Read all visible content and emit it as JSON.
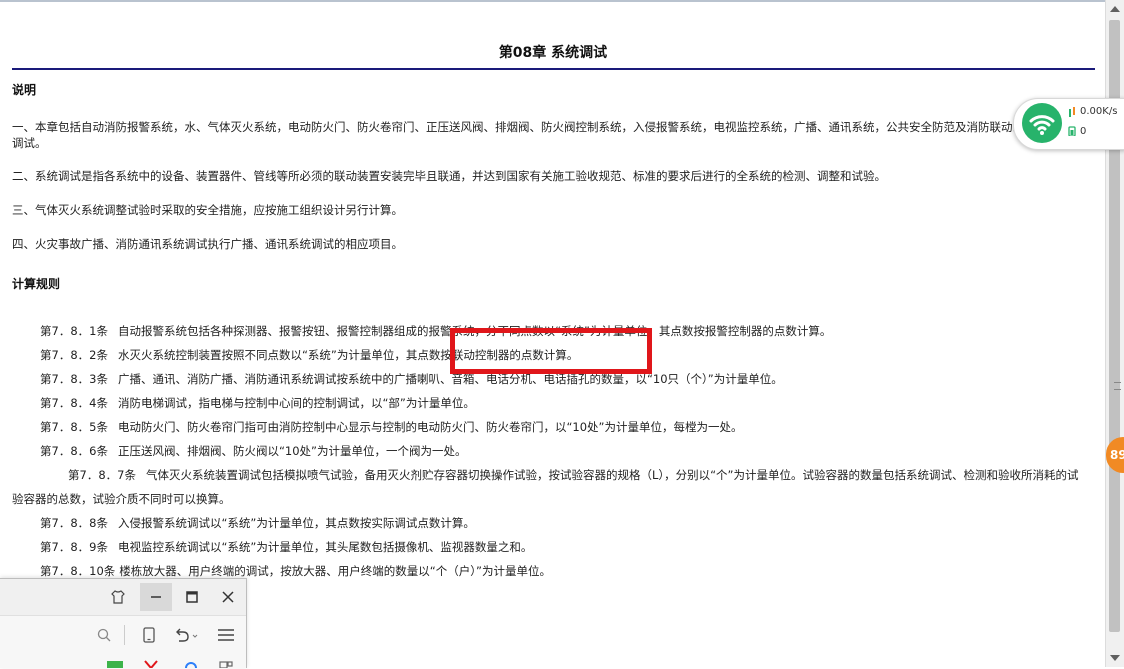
{
  "document": {
    "title": "第08章 系统调试",
    "section_notes_heading": "说明",
    "notes": [
      "一、本章包括自动消防报警系统，水、气体灭火系统，电动防火门、防火卷帘门、正压送风阀、排烟阀、防火阀控制系统，入侵报警系统，电视监控系统，广播、通讯系统，公共安全防范及消防联动系统等的系统调试。",
      "二、系统调试是指各系统中的设备、装置器件、管线等所必须的联动装置安装完毕且联通，并达到国家有关施工验收规范、标准的要求后进行的全系统的检测、调整和试验。",
      "三、气体灭火系统调整试验时采取的安全措施，应按施工组织设计另行计算。",
      "四、火灾事故广播、消防通讯系统调试执行广播、通讯系统调试的相应项目。"
    ],
    "section_rules_heading": "计算规则",
    "rules": [
      {
        "num": "第7．8．1条",
        "text": "自动报警系统包括各种探测器、报警按钮、报警控制器组成的报警系统，分不同点数以“系统”为计量单位，其点数按报警控制器的点数计算。"
      },
      {
        "num": "第7．8．2条",
        "text": "水灭火系统控制装置按照不同点数以“系统”为计量单位，其点数按联动控制器的点数计算。"
      },
      {
        "num": "第7．8．3条",
        "text": "广播、通讯、消防广播、消防通讯系统调试按系统中的广播喇叭、音箱、电话分机、电话插孔的数量，以“10只（个）”为计量单位。"
      },
      {
        "num": "第7．8．4条",
        "text": "消防电梯调试，指电梯与控制中心间的控制调试，以“部”为计量单位。"
      },
      {
        "num": "第7．8．5条",
        "text": "电动防火门、防火卷帘门指可由消防控制中心显示与控制的电动防火门、防火卷帘门，以“10处”为计量单位，每樘为一处。"
      },
      {
        "num": "第7．8．6条",
        "text": "正压送风阀、排烟阀、防火阀以“10处”为计量单位，一个阀为一处。"
      },
      {
        "num": "第7．8．7条",
        "text": "气体灭火系统装置调试包括模拟喷气试验，备用灭火剂贮存容器切换操作试验，按试验容器的规格（L），分别以“个”为计量单位。试验容器的数量包括系统调试、检测和验收所消耗的试验容器的总数，试验介质不同时可以换算。"
      },
      {
        "num": "第7．8．8条",
        "text": "入侵报警系统调试以“系统”为计量单位，其点数按实际调试点数计算。"
      },
      {
        "num": "第7．8．9条",
        "text": "电视监控系统调试以“系统”为计量单位，其头尾数包括摄像机、监视器数量之和。"
      },
      {
        "num": "第7．8．10条",
        "text": "楼栋放大器、用户终端的调试，按放大器、用户终端的数量以“个（户）”为计量单位。"
      }
    ]
  },
  "network_widget": {
    "speed": "0.00K/s",
    "count": "0",
    "color": "#27b36b"
  },
  "badge": {
    "value": "89",
    "color": "#f18a24"
  },
  "highlight_color": "#e0161a",
  "mini_window": {
    "title_icons": [
      "shirt-icon",
      "minimize-icon",
      "maximize-icon",
      "close-icon"
    ],
    "toolbar_icons": [
      "search-icon",
      "phone-icon",
      "undo-icon",
      "menu-icon"
    ]
  }
}
